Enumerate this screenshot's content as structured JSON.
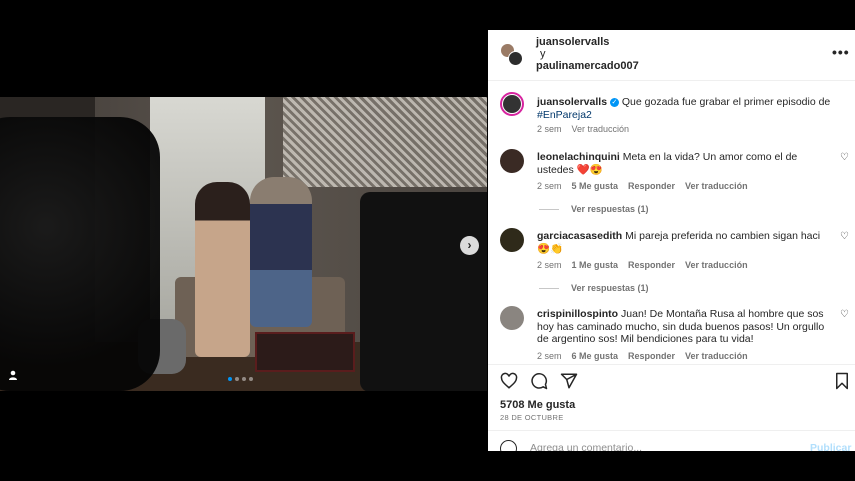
{
  "post": {
    "carousel_dots": 4,
    "active_dot": 0,
    "next_icon": "chevron-right-icon",
    "tag_icon": "user-tag-icon"
  },
  "header": {
    "user1": "juansolervalls",
    "conj": "y",
    "user2": "paulinamercado007",
    "more_icon": "more-horizontal-icon"
  },
  "caption": {
    "username": "juansolervalls",
    "text": "Que gozada fue grabar el primer episodio de",
    "hashtag": "#EnPareja2",
    "time": "2 sem",
    "translate": "Ver traducción"
  },
  "comments": [
    {
      "username": "leonelachinquini",
      "text": "Meta en la vida? Un amor como el de ustedes ❤️😍",
      "time": "2 sem",
      "likes": "5 Me gusta",
      "reply": "Responder",
      "translate": "Ver traducción",
      "replies": "Ver respuestas (1)"
    },
    {
      "username": "garciacasasedith",
      "text": "Mi pareja preferida no cambien sigan haci😍👏",
      "time": "2 sem",
      "likes": "1 Me gusta",
      "reply": "Responder",
      "translate": "Ver traducción",
      "replies": "Ver respuestas (1)"
    },
    {
      "username": "crispinillospinto",
      "text": "Juan! De Montaña Rusa al hombre que sos hoy has caminado mucho, sin duda buenos pasos! Un orgullo de argentino sos! Mil bendiciones para tu vida!",
      "time": "2 sem",
      "likes": "6 Me gusta",
      "reply": "Responder",
      "translate": "Ver traducción"
    }
  ],
  "stats": {
    "likes": "5708 Me gusta",
    "date": "28 DE OCTUBRE"
  },
  "comment_input": {
    "placeholder": "Agrega un comentario...",
    "publish": "Publicar"
  },
  "colors": {
    "verified": "#0095f6",
    "link": "#00376b",
    "publish_disabled": "#b2dffc"
  }
}
